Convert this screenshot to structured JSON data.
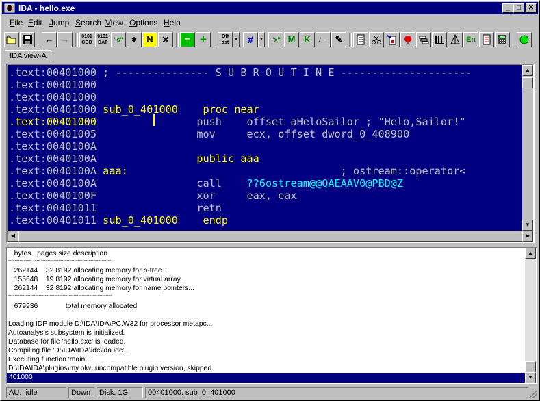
{
  "window": {
    "title": "IDA - hello.exe"
  },
  "menu": [
    "File",
    "Edit",
    "Jump",
    "Search",
    "View",
    "Options",
    "Help"
  ],
  "toolbar": {
    "buttons": [
      {
        "name": "open-button",
        "label": ""
      },
      {
        "name": "save-button",
        "label": ""
      },
      {
        "name": "back-button",
        "label": "←"
      },
      {
        "name": "forward-button",
        "label": "→"
      },
      {
        "name": "code-button",
        "label": "0101\nCOD"
      },
      {
        "name": "data-button",
        "label": "0101\nDAT"
      },
      {
        "name": "string-button",
        "label": "\"s\""
      },
      {
        "name": "undefine-star-button",
        "label": "✱"
      },
      {
        "name": "name-button",
        "label": "N"
      },
      {
        "name": "delete-button",
        "label": "✕"
      },
      {
        "name": "collapse-button",
        "label": "−"
      },
      {
        "name": "expand-button",
        "label": "+"
      },
      {
        "name": "offset-button",
        "label": "Off\ndst"
      },
      {
        "name": "hash-button",
        "label": "#"
      },
      {
        "name": "x-button",
        "label": "\"x\""
      },
      {
        "name": "m-button",
        "label": "M"
      },
      {
        "name": "k-button",
        "label": "K"
      },
      {
        "name": "dash-button",
        "label": "/—"
      },
      {
        "name": "pen-button",
        "label": "✎"
      },
      {
        "name": "doc1-button",
        "label": ""
      },
      {
        "name": "tools-button",
        "label": ""
      },
      {
        "name": "doc2-button",
        "label": ""
      },
      {
        "name": "flag-button",
        "label": ""
      },
      {
        "name": "stack-button",
        "label": ""
      },
      {
        "name": "bars-button",
        "label": ""
      },
      {
        "name": "tree-button",
        "label": ""
      },
      {
        "name": "en-button",
        "label": "En"
      },
      {
        "name": "doc3-button",
        "label": ""
      },
      {
        "name": "calc-button",
        "label": ""
      },
      {
        "name": "run-button",
        "label": ""
      }
    ]
  },
  "tab": {
    "label": "IDA view-A"
  },
  "disasm": {
    "lines": [
      {
        "addr": ".text:00401000",
        "rest": " ; --------------- S U B R O U T I N E ---------------------"
      },
      {
        "addr": ".text:00401000",
        "rest": ""
      },
      {
        "addr": ".text:00401000",
        "rest": ""
      },
      {
        "addr": ".text:00401000",
        "label": "sub_0_401000",
        "kw": "proc near"
      },
      {
        "addr": ".text:00401000",
        "mnem": "push",
        "ops": "offset aHeloSailor ; \"Helo,Sailor!\""
      },
      {
        "addr": ".text:00401005",
        "mnem": "mov",
        "ops": "ecx, offset dword_0_408900"
      },
      {
        "addr": ".text:0040100A",
        "rest": ""
      },
      {
        "addr": ".text:0040100A",
        "kw": "public aaa"
      },
      {
        "addr": ".text:0040100A",
        "label": "aaa:",
        "cmt": "; ostream::operator<"
      },
      {
        "addr": ".text:0040100A",
        "mnem": "call",
        "ext": "??6ostream@@QAEAAV0@PBD@Z"
      },
      {
        "addr": ".text:0040100F",
        "mnem": "xor",
        "ops": "eax, eax"
      },
      {
        "addr": ".text:00401011",
        "mnem": "retn"
      },
      {
        "addr": ".text:00401011",
        "label": "sub_0_401000",
        "kw": "endp"
      }
    ]
  },
  "output": {
    "lines": [
      "   bytes   pages size description",
      "--------- ----- ---- --------------------------------------------",
      "   262144    32 8192 allocating memory for b-tree...",
      "   155648    19 8192 allocating memory for virtual array...",
      "   262144    32 8192 allocating memory for name pointers...",
      "-----------------------------------------------------------------",
      "   679936              total memory allocated",
      "",
      "Loading IDP module D:\\IDA\\IDA\\PC.W32 for processor metapc...",
      "Autoanalysis subsystem is initialized.",
      "Database for file 'hello.exe' is loaded.",
      "Compiling file 'D:\\IDA\\IDA\\idc\\ida.idc'...",
      "Executing function 'main'...",
      "D:\\IDA\\IDA\\plugins\\my.plw: uncompatible plugin version, skipped"
    ],
    "command": "401000"
  },
  "status": {
    "au": "AU:  idle",
    "down": "Down",
    "disk": "Disk: 1G",
    "location": "00401000: sub_0_401000"
  }
}
